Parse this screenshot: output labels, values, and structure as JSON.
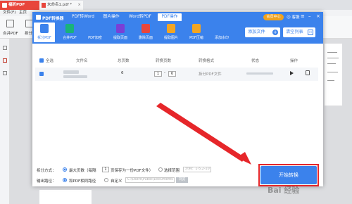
{
  "app": {
    "tab_label": "福昕PDF",
    "doc_tab_label": "未命名1.pdf *",
    "menu": [
      "文件(F)",
      "主页"
    ],
    "toolbar": [
      {
        "label": "合并PDF"
      },
      {
        "label": "拆分"
      }
    ]
  },
  "dialog": {
    "title": "PDF转换器",
    "top_tabs": [
      {
        "label": "PDF转Word"
      },
      {
        "label": "图片操作"
      },
      {
        "label": "Word转PDF"
      },
      {
        "label": "PDF操作"
      }
    ],
    "vip_label": "会员中心",
    "help_label": "客服",
    "tools": [
      {
        "label": "拆分PDF",
        "color": "#3b82ec"
      },
      {
        "label": "合并PDF",
        "color": "#19b37a"
      },
      {
        "label": "PDF加密",
        "color": "#3b82ec"
      },
      {
        "label": "提取页面",
        "color": "#7a3fd6"
      },
      {
        "label": "删除页面",
        "color": "#e8463c"
      },
      {
        "label": "提取图片",
        "color": "#f2a523"
      },
      {
        "label": "PDF压缩",
        "color": "#f2a523"
      },
      {
        "label": "添加水印",
        "color": "#3b82ec"
      }
    ],
    "add_file_label": "添加文件",
    "clear_list_label": "清空列表",
    "columns": [
      "全选",
      "文件名",
      "总页数",
      "转换页数",
      "转换格式",
      "状态",
      "操作"
    ],
    "rows": [
      {
        "total_pages": "6",
        "page_from": "1",
        "page_to": "6",
        "format": "拆分PDF文件"
      }
    ],
    "options": {
      "split_mode_label": "拆分方式：",
      "max_pages_label": "最大页数（每隔",
      "max_pages_value": "1",
      "max_pages_suffix": "页保存为一份PDF文件）",
      "range_label": "选择范围",
      "range_placeholder": "示例：1-5,2-10",
      "output_label": "输出路径：",
      "same_dir_label": "和PDF相同路径",
      "custom_label": "自定义",
      "custom_path": "C:\\Users\\Public\\Documents",
      "browse_label": "浏览"
    },
    "start_label": "开始转换"
  },
  "watermark": "Bai 经验"
}
